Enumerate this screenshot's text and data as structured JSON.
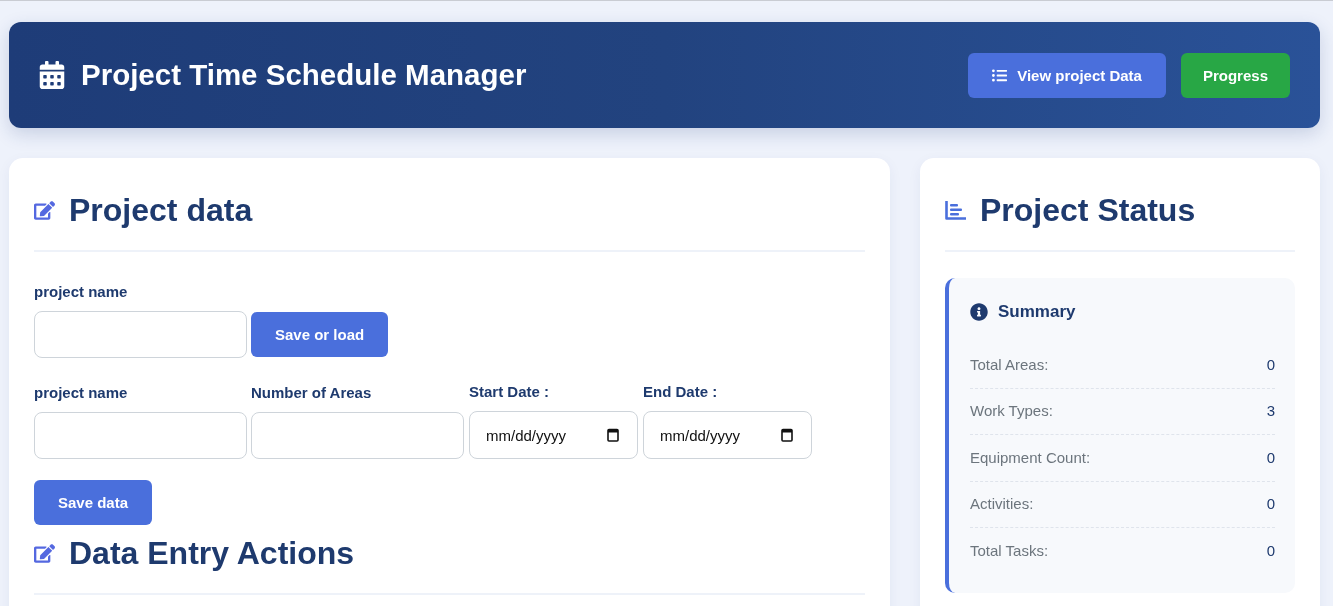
{
  "header": {
    "title": "Project Time Schedule Manager",
    "buttons": [
      {
        "label": "View project Data",
        "kind": "primary"
      },
      {
        "label": "Progress",
        "kind": "success"
      }
    ]
  },
  "project_data": {
    "heading": "Project data",
    "lookup": {
      "label": "project name",
      "button": "Save or load"
    },
    "fields": [
      {
        "kind": "text",
        "label": "project name"
      },
      {
        "kind": "text",
        "label": "Number of Areas"
      },
      {
        "kind": "date",
        "label": "Start Date :",
        "placeholder": "mm/dd/yyyy"
      },
      {
        "kind": "date",
        "label": "End Date :",
        "placeholder": "mm/dd/yyyy"
      }
    ],
    "save_button": "Save data"
  },
  "data_entry": {
    "heading": "Data Entry Actions"
  },
  "project_status": {
    "heading": "Project Status",
    "summary": {
      "title": "Summary",
      "rows": [
        {
          "label": "Total Areas:",
          "value": "0"
        },
        {
          "label": "Work Types:",
          "value": "3"
        },
        {
          "label": "Equipment Count:",
          "value": "0"
        },
        {
          "label": "Activities:",
          "value": "0"
        },
        {
          "label": "Total Tasks:",
          "value": "0"
        }
      ]
    }
  }
}
